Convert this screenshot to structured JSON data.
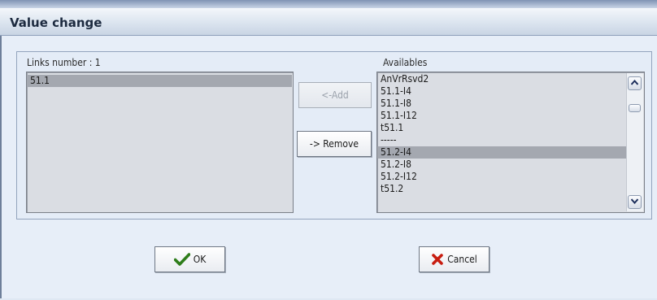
{
  "window": {
    "title": "Value change"
  },
  "links": {
    "label": "Links number : 1",
    "items": [
      "51.1"
    ],
    "selected_index": 0
  },
  "availables": {
    "label": "Availables",
    "items": [
      "AnVrRsvd2",
      "51.1-I4",
      "51.1-I8",
      "51.1-I12",
      "t51.1",
      "-----",
      "51.2-I4",
      "51.2-I8",
      "51.2-I12",
      "t51.2"
    ],
    "selected_index": 6
  },
  "buttons": {
    "add_label": "<-Add",
    "remove_label": "-> Remove",
    "ok_label": "OK",
    "cancel_label": "Cancel"
  },
  "colors": {
    "ok_check": "#2e7d1a",
    "cancel_x": "#c81d10"
  },
  "icons": {
    "ok": "checkmark-icon",
    "cancel": "x-mark-icon",
    "scroll_up": "chevron-up-icon",
    "scroll_down": "chevron-down-icon"
  }
}
